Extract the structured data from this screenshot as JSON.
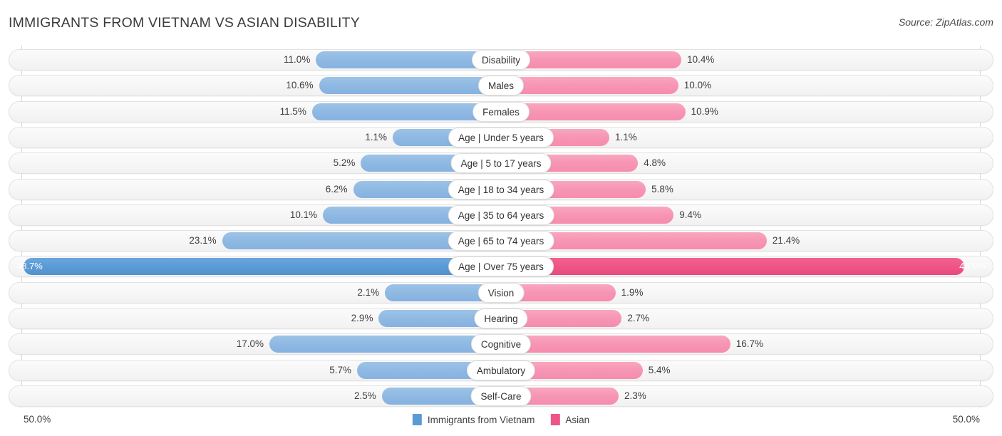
{
  "header": {
    "title": "IMMIGRANTS FROM VIETNAM VS ASIAN DISABILITY",
    "source": "Source: ZipAtlas.com"
  },
  "axis": {
    "left_label": "50.0%",
    "right_label": "50.0%",
    "max": 50.0
  },
  "legend": {
    "items": [
      {
        "label": "Immigrants from Vietnam",
        "color": "#5b9bd5"
      },
      {
        "label": "Asian",
        "color": "#ee5586"
      }
    ]
  },
  "colors": {
    "left_normal": "#8fb9e3",
    "right_normal": "#f795b4",
    "left_highlight": "#5b9bd5",
    "right_highlight": "#ee5586",
    "track": "#f6f6f6",
    "gridline": "#d8d8d8"
  },
  "chart_data": {
    "type": "bar",
    "title": "IMMIGRANTS FROM VIETNAM VS ASIAN DISABILITY",
    "subtitle": "Source: ZipAtlas.com",
    "orientation": "horizontal",
    "layout": "diverging-bidirectional",
    "xlabel": "",
    "ylabel": "",
    "xlim": [
      -50.0,
      50.0
    ],
    "axis_tick_labels": [
      "50.0%",
      "50.0%"
    ],
    "grid": true,
    "legend_position": "bottom-center",
    "categories": [
      "Disability",
      "Males",
      "Females",
      "Age | Under 5 years",
      "Age | 5 to 17 years",
      "Age | 18 to 34 years",
      "Age | 35 to 64 years",
      "Age | 65 to 74 years",
      "Age | Over 75 years",
      "Vision",
      "Hearing",
      "Cognitive",
      "Ambulatory",
      "Self-Care"
    ],
    "series": [
      {
        "name": "Immigrants from Vietnam",
        "side": "left",
        "color": "#8fb9e3",
        "values": [
          11.0,
          10.6,
          11.5,
          1.1,
          5.2,
          6.2,
          10.1,
          23.1,
          48.7,
          2.1,
          2.9,
          17.0,
          5.7,
          2.5
        ],
        "labels": [
          "11.0%",
          "10.6%",
          "11.5%",
          "1.1%",
          "5.2%",
          "6.2%",
          "10.1%",
          "23.1%",
          "48.7%",
          "2.1%",
          "2.9%",
          "17.0%",
          "5.7%",
          "2.5%"
        ]
      },
      {
        "name": "Asian",
        "side": "right",
        "color": "#f795b4",
        "values": [
          10.4,
          10.0,
          10.9,
          1.1,
          4.8,
          5.8,
          9.4,
          21.4,
          46.9,
          1.9,
          2.7,
          16.7,
          5.4,
          2.3
        ],
        "labels": [
          "10.4%",
          "10.0%",
          "10.9%",
          "1.1%",
          "4.8%",
          "5.8%",
          "9.4%",
          "21.4%",
          "46.9%",
          "1.9%",
          "2.7%",
          "16.7%",
          "5.4%",
          "2.3%"
        ]
      }
    ],
    "highlighted_category": "Age | Over 75 years"
  },
  "rows": [
    {
      "label": "Disability",
      "left": "11.0%",
      "right": "10.4%",
      "left_val": 11.0,
      "right_val": 10.4,
      "highlight": false
    },
    {
      "label": "Males",
      "left": "10.6%",
      "right": "10.0%",
      "left_val": 10.6,
      "right_val": 10.0,
      "highlight": false
    },
    {
      "label": "Females",
      "left": "11.5%",
      "right": "10.9%",
      "left_val": 11.5,
      "right_val": 10.9,
      "highlight": false
    },
    {
      "label": "Age | Under 5 years",
      "left": "1.1%",
      "right": "1.1%",
      "left_val": 1.1,
      "right_val": 1.1,
      "highlight": false
    },
    {
      "label": "Age | 5 to 17 years",
      "left": "5.2%",
      "right": "4.8%",
      "left_val": 5.2,
      "right_val": 4.8,
      "highlight": false
    },
    {
      "label": "Age | 18 to 34 years",
      "left": "6.2%",
      "right": "5.8%",
      "left_val": 6.2,
      "right_val": 5.8,
      "highlight": false
    },
    {
      "label": "Age | 35 to 64 years",
      "left": "10.1%",
      "right": "9.4%",
      "left_val": 10.1,
      "right_val": 9.4,
      "highlight": false
    },
    {
      "label": "Age | 65 to 74 years",
      "left": "23.1%",
      "right": "21.4%",
      "left_val": 23.1,
      "right_val": 21.4,
      "highlight": false
    },
    {
      "label": "Age | Over 75 years",
      "left": "48.7%",
      "right": "46.9%",
      "left_val": 48.7,
      "right_val": 46.9,
      "highlight": true
    },
    {
      "label": "Vision",
      "left": "2.1%",
      "right": "1.9%",
      "left_val": 2.1,
      "right_val": 1.9,
      "highlight": false
    },
    {
      "label": "Hearing",
      "left": "2.9%",
      "right": "2.7%",
      "left_val": 2.9,
      "right_val": 2.7,
      "highlight": false
    },
    {
      "label": "Cognitive",
      "left": "17.0%",
      "right": "16.7%",
      "left_val": 17.0,
      "right_val": 16.7,
      "highlight": false
    },
    {
      "label": "Ambulatory",
      "left": "5.7%",
      "right": "5.4%",
      "left_val": 5.7,
      "right_val": 5.4,
      "highlight": false
    },
    {
      "label": "Self-Care",
      "left": "2.5%",
      "right": "2.3%",
      "left_val": 2.5,
      "right_val": 2.3,
      "highlight": false
    }
  ]
}
